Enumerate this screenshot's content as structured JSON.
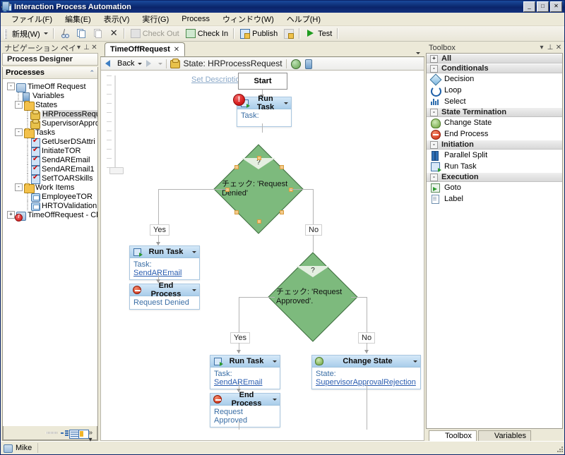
{
  "window": {
    "title": "Interaction Process Automation",
    "icon": "app-icon",
    "buttons": {
      "minimize": "_",
      "maximize": "□",
      "close": "✕"
    }
  },
  "menubar": {
    "items": [
      {
        "label": "ファイル(F)"
      },
      {
        "label": "編集(E)"
      },
      {
        "label": "表示(V)"
      },
      {
        "label": "実行(G)"
      },
      {
        "label": "Process"
      },
      {
        "label": "ウィンドウ(W)"
      },
      {
        "label": "ヘルプ(H)"
      }
    ]
  },
  "toolbar": {
    "items": [
      {
        "label": "新規(W)",
        "icon": "new-icon",
        "dropdown": true,
        "enabled": true
      },
      {
        "label": "",
        "icon": "cut-icon",
        "enabled": true
      },
      {
        "label": "",
        "icon": "copy-icon",
        "enabled": true
      },
      {
        "label": "",
        "icon": "paste-icon",
        "enabled": false
      },
      {
        "label": "",
        "icon": "delete-icon",
        "enabled": true
      },
      {
        "label": "Check Out",
        "icon": "check-out-icon",
        "enabled": false
      },
      {
        "label": "Check In",
        "icon": "check-in-icon",
        "enabled": true
      },
      {
        "label": "Publish",
        "icon": "publish-icon",
        "enabled": true
      },
      {
        "label": "",
        "icon": "save-icon",
        "enabled": false
      },
      {
        "label": "Test",
        "icon": "play-icon",
        "enabled": true
      }
    ]
  },
  "navigation": {
    "header": "ナビゲーション ペイン",
    "header_buttons": {
      "dropdown": "▾",
      "pin": "⊥",
      "close": "✕"
    },
    "designer_title": "Process Designer",
    "processes_header": "Processes",
    "processes_collapse": "⌃",
    "tree": [
      {
        "depth": 0,
        "label": "TimeOff Request",
        "icon": "process-icon",
        "toggle": "-",
        "selected": false
      },
      {
        "depth": 1,
        "label": "Variables",
        "icon": "variables-icon",
        "toggle": "",
        "selected": false
      },
      {
        "depth": 1,
        "label": "States",
        "icon": "folder-icon",
        "toggle": "-",
        "selected": false
      },
      {
        "depth": 2,
        "label": "HRProcessRequ",
        "icon": "state-icon",
        "toggle": "",
        "selected": true
      },
      {
        "depth": 2,
        "label": "SupervisorAppro",
        "icon": "state-icon",
        "toggle": "",
        "selected": false
      },
      {
        "depth": 1,
        "label": "Tasks",
        "icon": "folder-icon",
        "toggle": "-",
        "selected": false
      },
      {
        "depth": 2,
        "label": "GetUserDSAttri",
        "icon": "task-icon",
        "toggle": "",
        "selected": false
      },
      {
        "depth": 2,
        "label": "InitiateTOR",
        "icon": "task-icon",
        "toggle": "",
        "selected": false
      },
      {
        "depth": 2,
        "label": "SendAREmail",
        "icon": "task-icon",
        "toggle": "",
        "selected": false
      },
      {
        "depth": 2,
        "label": "SendAREmail1",
        "icon": "task-icon",
        "toggle": "",
        "selected": false
      },
      {
        "depth": 2,
        "label": "SetTOARSkills",
        "icon": "task-icon",
        "toggle": "",
        "selected": false
      },
      {
        "depth": 1,
        "label": "Work Items",
        "icon": "folder-icon",
        "toggle": "-",
        "selected": false
      },
      {
        "depth": 2,
        "label": "EmployeeTOR",
        "icon": "work-item-icon",
        "toggle": "",
        "selected": false
      },
      {
        "depth": 2,
        "label": "HRTOValidation",
        "icon": "work-item-icon",
        "toggle": "",
        "selected": false
      },
      {
        "depth": 0,
        "label": "TimeOffRequest - Clon",
        "icon": "process-error-icon",
        "toggle": "+",
        "selected": false
      }
    ],
    "footer_icons": [
      "tree-view-icon",
      "grid-view-icon",
      "properties-icon",
      "more-icon"
    ]
  },
  "editor": {
    "tab": {
      "label": "TimeOffRequest",
      "close": "✕"
    },
    "tab_dropdown": "▾",
    "breadcrumb": {
      "back_label": "Back",
      "back_dropdown": "▾",
      "forward_dropdown": "▾",
      "title": "State: HRProcessRequest",
      "icon": "state-icon",
      "extra_icons": [
        "globe-icon",
        "database-icon"
      ]
    },
    "canvas": {
      "set_description": "Set Description",
      "nodes": [
        {
          "id": "start",
          "type": "start",
          "label": "Start"
        },
        {
          "id": "run-task-1",
          "type": "activity",
          "icon": "run-task-icon",
          "title": "Run Task",
          "body": "Task:",
          "body_link": "",
          "error": "!"
        },
        {
          "id": "decision-1",
          "type": "decision",
          "marker": "?",
          "text": "チェック: 'Request Denied'",
          "selected": true
        },
        {
          "id": "run-task-2",
          "type": "activity",
          "icon": "run-task-icon",
          "title": "Run Task",
          "body": "Task: ",
          "body_link": "SendAREmail"
        },
        {
          "id": "end-process-1",
          "type": "activity",
          "icon": "end-process-icon",
          "title": "End Process",
          "body": "Request Denied",
          "body_link": ""
        },
        {
          "id": "decision-2",
          "type": "decision",
          "marker": "?",
          "text": "チェック: 'Request Approved'."
        },
        {
          "id": "run-task-3",
          "type": "activity",
          "icon": "run-task-icon",
          "title": "Run Task",
          "body": "Task: ",
          "body_link": "SendAREmail"
        },
        {
          "id": "end-process-2",
          "type": "activity",
          "icon": "end-process-icon",
          "title": "End Process",
          "body": "Request Approved",
          "body_link": ""
        },
        {
          "id": "change-state-1",
          "type": "activity",
          "icon": "change-state-icon",
          "title": "Change State",
          "body": "State: ",
          "body_link": "SupervisorApprovalRejection"
        }
      ],
      "edge_labels": {
        "d1_yes": "Yes",
        "d1_no": "No",
        "d2_yes": "Yes",
        "d2_no": "No"
      }
    }
  },
  "toolbox": {
    "header": "Toolbox",
    "header_buttons": {
      "dropdown": "▾",
      "pin": "⊥",
      "close": "✕"
    },
    "groups": [
      {
        "label": "All",
        "toggle": "+",
        "items": []
      },
      {
        "label": "Conditionals",
        "toggle": "-",
        "items": [
          {
            "label": "Decision",
            "icon": "decision-icon"
          },
          {
            "label": "Loop",
            "icon": "loop-icon"
          },
          {
            "label": "Select",
            "icon": "select-icon"
          }
        ]
      },
      {
        "label": "State Termination",
        "toggle": "-",
        "items": [
          {
            "label": "Change State",
            "icon": "change-state-icon"
          },
          {
            "label": "End Process",
            "icon": "end-process-icon"
          }
        ]
      },
      {
        "label": "Initiation",
        "toggle": "-",
        "items": [
          {
            "label": "Parallel Split",
            "icon": "parallel-split-icon"
          },
          {
            "label": "Run Task",
            "icon": "run-task-icon"
          }
        ]
      },
      {
        "label": "Execution",
        "toggle": "-",
        "items": [
          {
            "label": "Goto",
            "icon": "goto-icon"
          },
          {
            "label": "Label",
            "icon": "label-icon"
          }
        ]
      }
    ],
    "tabs": [
      {
        "label": "Toolbox",
        "icon": "wrench-icon",
        "active": true
      },
      {
        "label": "Variables",
        "icon": "variables-icon",
        "active": false
      }
    ]
  },
  "statusbar": {
    "user": "Mike",
    "user_icon": "user-icon"
  },
  "colors": {
    "title_bar": "#0a246a",
    "decision_fill": "#7dba7d",
    "decision_border": "#3e6b3e",
    "activity_header": "#a9cdea",
    "link": "#2a5db0",
    "error_badge": "#d81e1e"
  }
}
